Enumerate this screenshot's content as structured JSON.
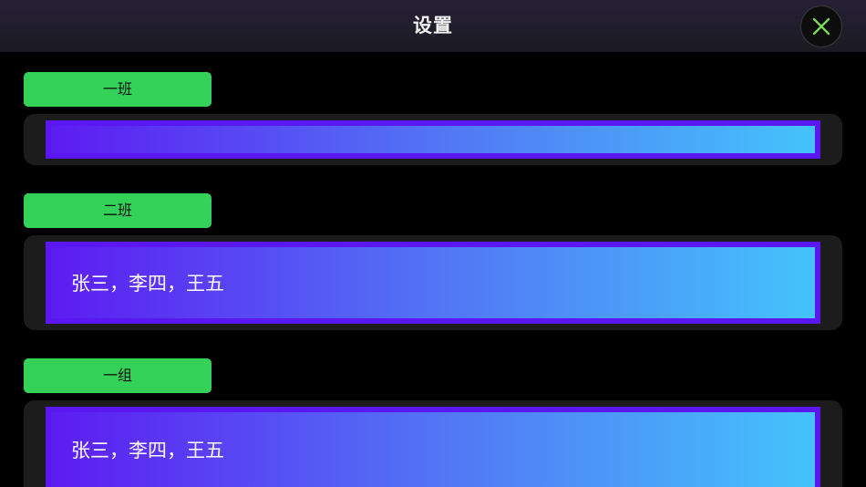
{
  "header": {
    "title": "设置"
  },
  "sections": [
    {
      "label": "一班",
      "value": ""
    },
    {
      "label": "二班",
      "value": "张三，李四，王五"
    },
    {
      "label": "一组",
      "value": "张三，李四，王五"
    }
  ],
  "colors": {
    "accent_green": "#33d158",
    "field_border": "#5a17f0",
    "gradient_start": "#5d1cf2",
    "gradient_end": "#45c3fb",
    "close_icon": "#7cd65c"
  },
  "icons": {
    "close": "close-icon"
  }
}
